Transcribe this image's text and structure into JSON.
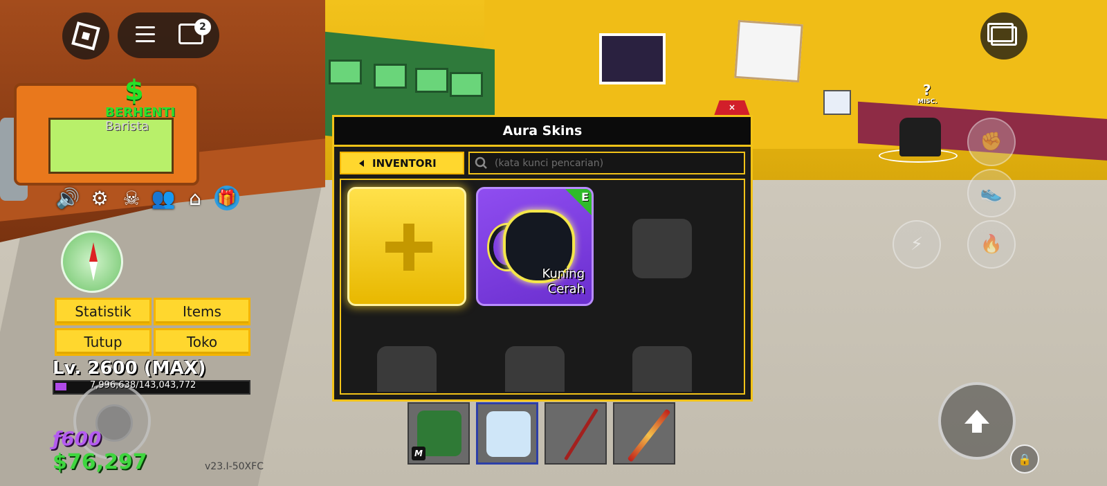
{
  "top_left": {
    "roblox_menu_icon": "roblox-logo-icon",
    "hamburger_icon": "hamburger-menu-icon",
    "chat_icon": "chat-icon",
    "chat_badge": "2"
  },
  "npc": {
    "dollar": "$",
    "status": "BERHENTI",
    "role": "Barista"
  },
  "hud_icons": [
    "speaker-icon",
    "gear-icon",
    "jolly-roger-icon",
    "crew-icon",
    "home-icon",
    "gift-icon"
  ],
  "menu_buttons": {
    "stats": "Statistik",
    "items": "Items",
    "close": "Tutup",
    "shop": "Toko"
  },
  "player": {
    "level": "Lv. 2600 (MAX)",
    "xp_text": "7,996,638/143,043,772",
    "xp_fraction": 0.056,
    "fragments": "ƒ600",
    "money": "$76,297"
  },
  "version": "v23.I-50XFC",
  "misc": {
    "question": "?",
    "label": "MISC."
  },
  "panel": {
    "title": "Aura Skins",
    "close_label": "×",
    "inventory_button": "INVENTORI",
    "search_placeholder": "(kata kunci pencarian)",
    "skin": {
      "name_line1": "Kuning",
      "name_line2": "Cerah",
      "equipped_letter": "E"
    }
  },
  "colors": {
    "accent_yellow": "#f3c318",
    "panel_bg": "#1b1b1b",
    "skin_purple": "#7a3be0",
    "equip_green": "#2fbb2a",
    "money_green": "#3fd63f",
    "fragment_purple": "#b45cf0"
  },
  "hotbar": [
    "dragon-fruit-icon",
    "yeti-fruit-icon",
    "red-katana-icon",
    "staff-weapon-icon"
  ]
}
